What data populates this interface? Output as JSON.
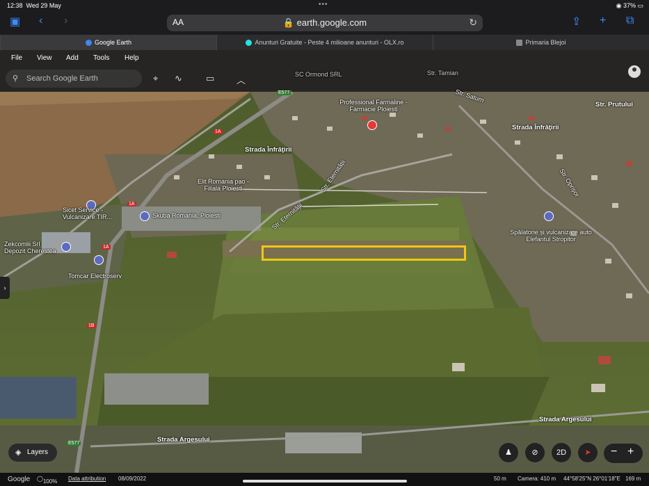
{
  "status": {
    "time": "12:38",
    "date": "Wed 29 May",
    "battery": "37%"
  },
  "browser": {
    "aa": "AA",
    "url": "earth.google.com",
    "reload_icon": "reload-icon"
  },
  "tabs": [
    {
      "label": "Google Earth",
      "favicon_color": "#4285f4"
    },
    {
      "label": "Anunturi Gratuite - Peste 4 milioane anunturi - OLX.ro",
      "favicon_color": "#23e5db"
    },
    {
      "label": "Primaria Blejoi",
      "favicon_color": "#888888"
    }
  ],
  "menu": {
    "items": [
      "File",
      "View",
      "Add",
      "Tools",
      "Help"
    ]
  },
  "search": {
    "placeholder": "Search Google Earth"
  },
  "map_labels": {
    "sc_ormond": "SC Ormond SRL",
    "str_taman": "Str. Tamian",
    "str_saturn": "Str. Saturn",
    "str_prutului": "Str. Prutului",
    "farmacie": "Professional Farmaline - Farmacie Ploiesti",
    "strada_infratirii_1": "Strada Înfrăţirii",
    "strada_infratirii_2": "Strada Înfrăţirii",
    "str_eternitatii_1": "Str. Eternității",
    "str_eternitatii_2": "Str. Eternității",
    "str_oprisor": "Str. Oprișor",
    "elit_romania": "Elit Romania pao - Filiala Ploiesti",
    "skuba": "Skuba Romania, Ploiesti",
    "sicet": "Sicet Service - Vulcanizare TIR...",
    "zekcomlii": "Zekcomlii Srl Depozit Cherestea",
    "tomcar": "Tomcar Electroserv",
    "spalatorie": "Spălatorie și vulcanizare auto Elefantul Stropitor",
    "strada_argesului_1": "Strada Argesului",
    "strada_argesului_2": "Strada Argesului"
  },
  "road_shields": {
    "e577_top": "E577",
    "a1_1": "1A",
    "a1_2": "1A",
    "a1_3": "1A",
    "b1": "1B",
    "e577_bottom": "E577"
  },
  "controls": {
    "layers": "Layers",
    "mode_2d": "2D"
  },
  "footer": {
    "brand": "Google",
    "zoom": "100%",
    "attribution": "Data attribution",
    "date": "08/09/2022",
    "scale": "50 m",
    "camera": "Camera: 410 m",
    "coords": "44°58'25\"N 26°01'18\"E",
    "elevation": "169 m"
  },
  "colors": {
    "highlight": "#f5c518",
    "accent": "#3d8bfd"
  }
}
